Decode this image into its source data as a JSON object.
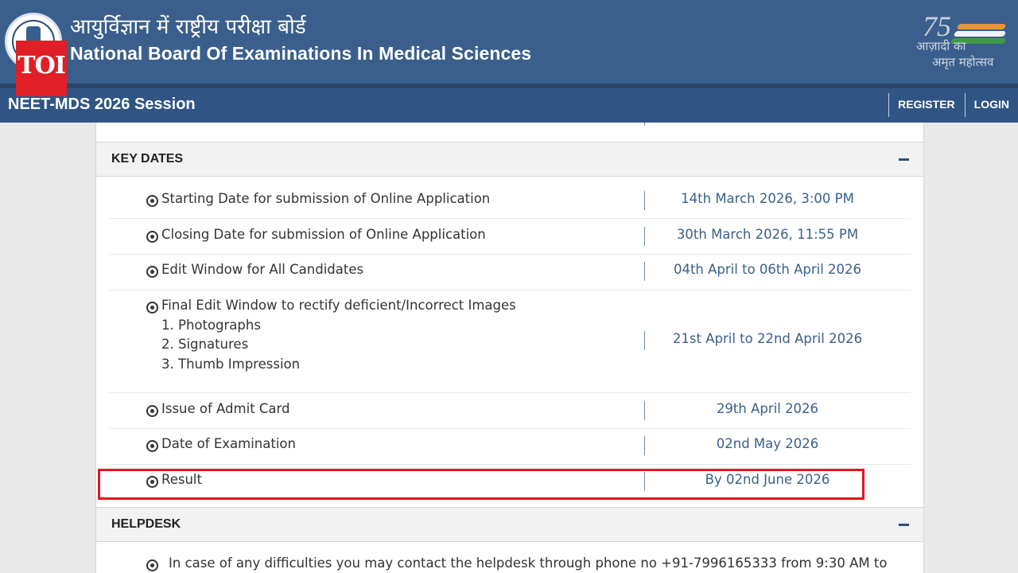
{
  "header": {
    "hindi_title": "आयुर्विज्ञान में राष्ट्रीय परीक्षा बोर्ड",
    "english_title": "National Board Of Examinations In Medical Sciences",
    "watermark": "TOI",
    "azadi_number": "75",
    "azadi_line1": "आज़ादी का",
    "azadi_line2": "अमृत महोत्सव"
  },
  "navbar": {
    "session": "NEET-MDS 2026 Session",
    "register": "REGISTER",
    "login": "LOGIN"
  },
  "key_dates": {
    "title": "KEY DATES",
    "rows": [
      {
        "label": "Starting Date for submission of Online Application",
        "date": "14th March 2026, 3:00 PM"
      },
      {
        "label": "Closing Date for submission of Online Application",
        "date": "30th March 2026, 11:55 PM"
      },
      {
        "label": "Edit Window for All Candidates",
        "date": "04th April to 06th April 2026"
      },
      {
        "label": "Final Edit Window to rectify deficient/Incorrect Images",
        "date": "21st April to 22nd April 2026",
        "subitems": [
          "1. Photographs",
          "2. Signatures",
          "3. Thumb Impression"
        ]
      },
      {
        "label": "Issue of Admit Card",
        "date": "29th April 2026"
      },
      {
        "label": "Date of Examination",
        "date": "02nd May 2026"
      },
      {
        "label": "Result",
        "date": "By 02nd June 2026"
      }
    ]
  },
  "helpdesk": {
    "title": "HELPDESK",
    "text": "In case of any difficulties you may contact the helpdesk through phone no +91-7996165333 from 9:30 AM to"
  },
  "colors": {
    "header_bg": "#3a5f8c",
    "navbar_bg": "#305584",
    "date_text": "#3a5f8c",
    "highlight": "#e0161c",
    "watermark_bg": "#e01f26"
  }
}
